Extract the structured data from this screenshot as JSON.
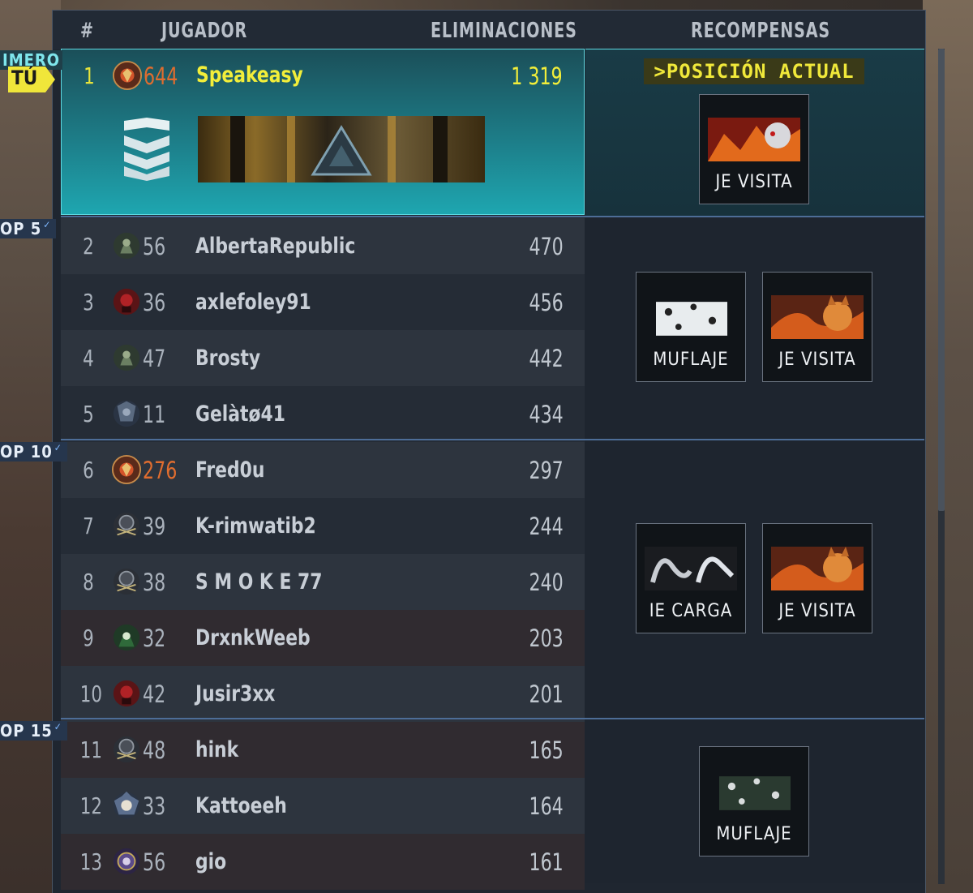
{
  "header": {
    "rank": "#",
    "player": "JUGADOR",
    "kills": "ELIMINACIONES",
    "rewards": "RECOMPENSAS"
  },
  "tiers": {
    "first": "IMERO",
    "top5": "OP 5",
    "top10": "OP 10",
    "top15": "OP 15"
  },
  "you_marker": "TÚ",
  "current_position": ">POSICIÓN ACTUAL",
  "me": {
    "rank": "1",
    "level": "644",
    "name": "Speakeasy",
    "kills": "1 319"
  },
  "rows": [
    {
      "rank": "2",
      "level": "56",
      "name": "AlbertaRepublic",
      "kills": "470"
    },
    {
      "rank": "3",
      "level": "36",
      "name": "axlefoley91",
      "kills": "456"
    },
    {
      "rank": "4",
      "level": "47",
      "name": "Brosty",
      "kills": "442"
    },
    {
      "rank": "5",
      "level": "11",
      "name": "Gelàtø41",
      "kills": "434"
    },
    {
      "rank": "6",
      "level": "276",
      "name": "Fred0u",
      "kills": "297"
    },
    {
      "rank": "7",
      "level": "39",
      "name": "K-rimwatib2",
      "kills": "244"
    },
    {
      "rank": "8",
      "level": "38",
      "name": "S M O K E 77",
      "kills": "240"
    },
    {
      "rank": "9",
      "level": "32",
      "name": "DrxnkWeeb",
      "kills": "203"
    },
    {
      "rank": "10",
      "level": "42",
      "name": "Jusir3xx",
      "kills": "201"
    },
    {
      "rank": "11",
      "level": "48",
      "name": "hink",
      "kills": "165"
    },
    {
      "rank": "12",
      "level": "33",
      "name": "Kattoeeh",
      "kills": "164"
    },
    {
      "rank": "13",
      "level": "56",
      "name": "gio",
      "kills": "161"
    }
  ],
  "rewards": {
    "first": {
      "label": "JE VISITA"
    },
    "top5": [
      {
        "label": "MUFLAJE"
      },
      {
        "label": "JE VISITA"
      }
    ],
    "top10": [
      {
        "label": "IE CARGA"
      },
      {
        "label": "JE VISITA"
      }
    ],
    "top15": [
      {
        "label": "MUFLAJE"
      }
    ]
  },
  "colors": {
    "accent_cyan": "#1ea6b0",
    "highlight_yellow": "#f2ee3a",
    "prestige_orange": "#e06d2f"
  }
}
